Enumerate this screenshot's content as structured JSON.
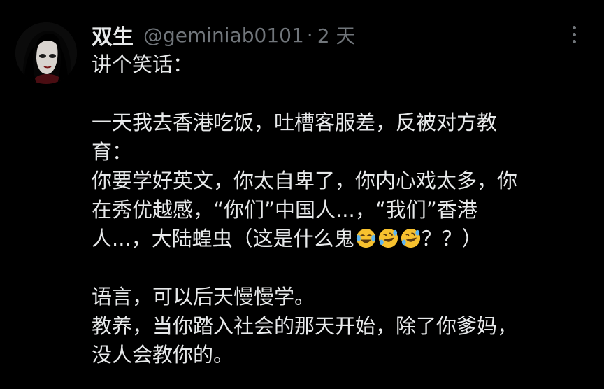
{
  "tweet": {
    "author": {
      "display_name": "双生",
      "handle": "@geminiab0101",
      "avatar_icon": "avatar-portrait"
    },
    "separator": "·",
    "timestamp": "2 天",
    "more_icon": "more-vertical-icon",
    "lines": [
      "讲个笑话：",
      "",
      "一天我去香港吃饭，吐槽客服差，反被对方教",
      "育：",
      "你要学好英文，你太自卑了，你内心戏太多，你",
      "在秀优越感，“你们”中国人...，“我们”香港",
      "人...，大陆蝗虫（这是什么鬼",
      "",
      "语言，可以后天慢慢学。",
      "教养，当你踏入社会的那天开始，除了你爹妈，",
      "没人会教你的。"
    ],
    "line7_suffix": "？？）",
    "emojis": [
      "face-with-tears-of-joy",
      "rolling-on-floor-laughing",
      "rolling-on-floor-laughing"
    ]
  },
  "colors": {
    "background": "#000000",
    "text": "#e7e9ea",
    "secondary": "#71767b",
    "emoji_yellow": "#f7c12e"
  }
}
